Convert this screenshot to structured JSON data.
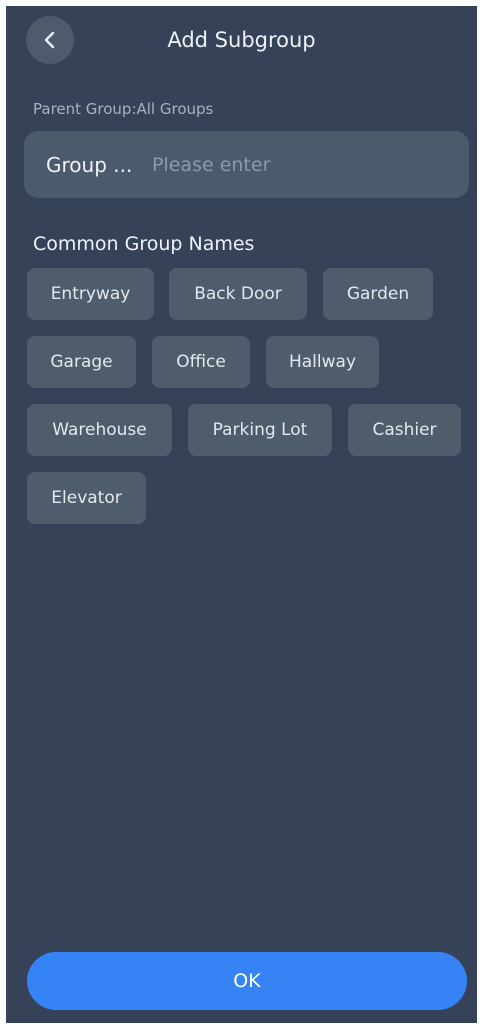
{
  "header": {
    "title": "Add Subgroup",
    "back_icon": "chevron-left-icon"
  },
  "parent_group": {
    "label": "Parent Group:All Groups"
  },
  "group_name_field": {
    "label": "Group ...",
    "value": "",
    "placeholder": "Please enter"
  },
  "common_names": {
    "title": "Common Group Names",
    "items": [
      "Entryway",
      "Back Door",
      "Garden",
      "Garage",
      "Office",
      "Hallway",
      "Warehouse",
      "Parking Lot",
      "Cashier",
      "Elevator"
    ]
  },
  "footer": {
    "ok_label": "OK"
  },
  "colors": {
    "background": "#364257",
    "input_background": "#4c5b6b",
    "chip_background": "#4f5c6c",
    "accent": "#3583f5"
  }
}
